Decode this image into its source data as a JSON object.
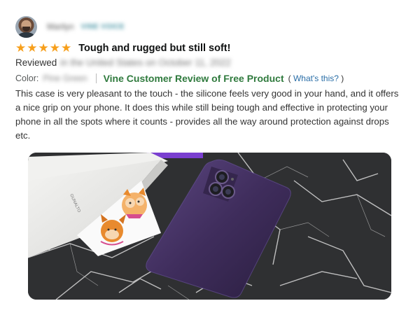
{
  "reviewer": {
    "name": "Marilyn",
    "badge": "VINE VOICE"
  },
  "review": {
    "rating": 5,
    "rating_max": 5,
    "title": "Tough and rugged but still soft!",
    "reviewed_label": "Reviewed",
    "reviewed_detail": "in the United States on October 11, 2022",
    "color_label": "Color:",
    "color_value": "Pine Green",
    "vine_label": "Vine Customer Review of Free Product",
    "whats_this_open": "(",
    "whats_this": "What's this?",
    "whats_this_close": ")",
    "body": "This case is very pleasant to the touch - the silicone feels very good in your hand, and it offers a nice grip on your phone. It does this while still being tough and effective in protecting your phone in all the spots where it counts - provides all the way around protection against drops etc."
  },
  "photo": {
    "box_brand": "GUNALTO"
  },
  "colors": {
    "star": "#f79f1b",
    "vine_green": "#2f7a3d",
    "link_blue": "#2a6ea7",
    "case_purple": "#3f2d5c",
    "marble": "#2f3032"
  }
}
